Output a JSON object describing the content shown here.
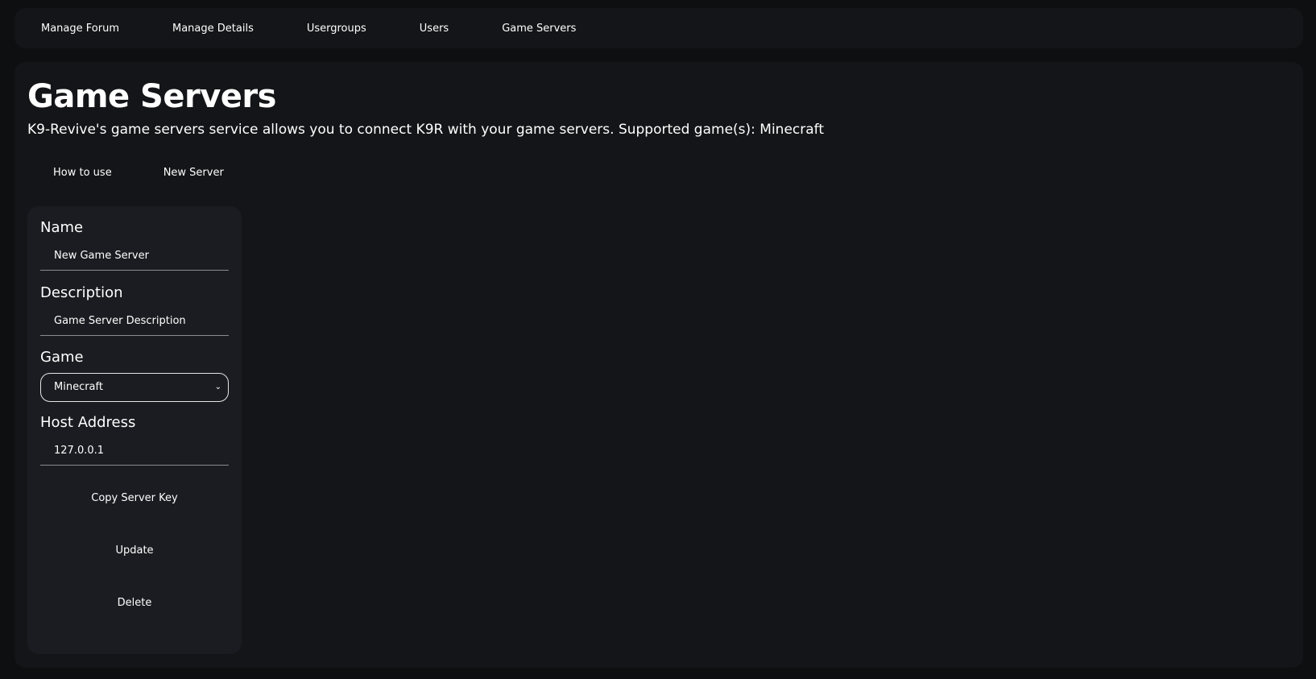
{
  "nav": {
    "items": [
      "Manage Forum",
      "Manage Details",
      "Usergroups",
      "Users",
      "Game Servers"
    ]
  },
  "page": {
    "title": "Game Servers",
    "subtitle": "K9-Revive's game servers service allows you to connect K9R with your game servers. Supported game(s): Minecraft"
  },
  "actions": {
    "how_to_use": "How to use",
    "new_server": "New Server"
  },
  "server_card": {
    "name_label": "Name",
    "name_value": "New Game Server",
    "description_label": "Description",
    "description_value": "Game Server Description",
    "game_label": "Game",
    "game_value": "Minecraft",
    "host_label": "Host Address",
    "host_value": "127.0.0.1",
    "copy_key_label": "Copy Server Key",
    "update_label": "Update",
    "delete_label": "Delete"
  },
  "colors": {
    "background": "#0e0f11",
    "panel": "#141518",
    "card": "#1b1c21",
    "text": "#ffffff"
  }
}
